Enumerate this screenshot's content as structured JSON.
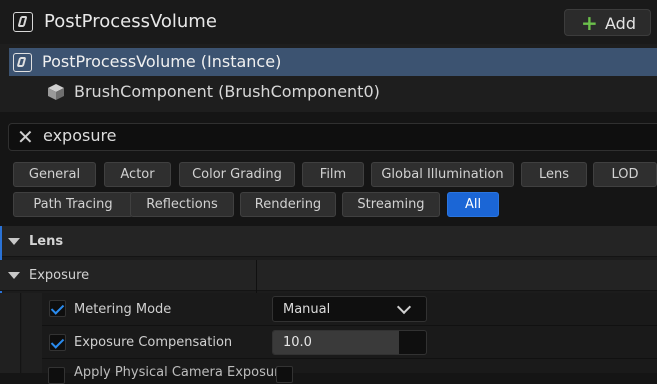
{
  "header": {
    "title": "PostProcessVolume",
    "icon": "post-process-volume-icon",
    "add_button": {
      "label": "Add",
      "icon": "plus-icon",
      "icon_color": "#6bc04b"
    }
  },
  "components": [
    {
      "label": "PostProcessVolume (Instance)",
      "icon": "post-process-volume-icon",
      "selected": true
    },
    {
      "label": "BrushComponent (BrushComponent0)",
      "icon": "cube-icon",
      "selected": false
    }
  ],
  "search": {
    "value": "exposure",
    "clear_icon": "close-icon"
  },
  "filters": {
    "row1": [
      "General",
      "Actor",
      "Color Grading",
      "Film",
      "Global Illumination",
      "Lens",
      "LOD"
    ],
    "row2": [
      "Path Tracing",
      "Reflections",
      "Rendering",
      "Streaming",
      "All"
    ],
    "active": "All",
    "active_color": "#1b66d6"
  },
  "details": {
    "category": "Lens",
    "subcategory": "Exposure",
    "properties": [
      {
        "label": "Metering Mode",
        "checked": true,
        "value": "Manual",
        "type": "dropdown"
      },
      {
        "label": "Exposure Compensation",
        "checked": true,
        "value": "10.0",
        "type": "number"
      },
      {
        "label": "Apply Physical Camera Exposure",
        "checked": false,
        "type": "checkbox"
      }
    ]
  }
}
